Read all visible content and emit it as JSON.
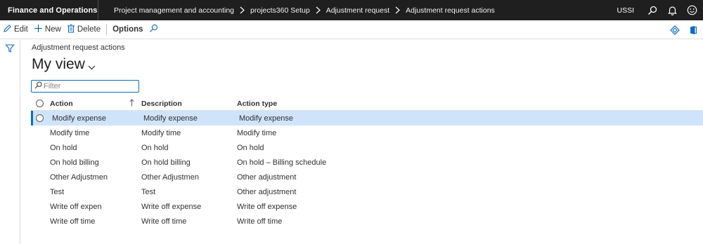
{
  "topbar": {
    "app_name": "Finance and Operations",
    "breadcrumbs": [
      "Project management and accounting",
      "projects360 Setup",
      "Adjustment request",
      "Adjustment request actions"
    ],
    "company": "USSI"
  },
  "actionpane": {
    "edit": "Edit",
    "new": "New",
    "delete": "Delete",
    "options": "Options"
  },
  "page": {
    "caption": "Adjustment request actions",
    "view_name": "My view",
    "filter_placeholder": "Filter"
  },
  "grid": {
    "columns": [
      "Action",
      "Description",
      "Action type"
    ],
    "rows": [
      {
        "action": "Modify expense",
        "description": "Modify expense",
        "type": "Modify expense"
      },
      {
        "action": "Modify time",
        "description": "Modify time",
        "type": "Modify time"
      },
      {
        "action": "On hold",
        "description": "On hold",
        "type": "On hold"
      },
      {
        "action": "On hold billing",
        "description": "On hold billing",
        "type": "On hold – Billing schedule"
      },
      {
        "action": "Other Adjustmen",
        "description": "Other Adjustmen",
        "type": "Other adjustment"
      },
      {
        "action": "Test",
        "description": "Test",
        "type": "Other adjustment"
      },
      {
        "action": "Write off expen",
        "description": "Write off expense",
        "type": "Write off expense"
      },
      {
        "action": "Write off time",
        "description": "Write off time",
        "type": "Write off time"
      }
    ],
    "selected_row": 0
  },
  "colors": {
    "topbar_bg": "#1f1f1f",
    "accent": "#0f6cbd",
    "selected_row_bg": "#cfe4fa"
  },
  "icons": [
    "search-icon",
    "bell-icon",
    "smiley-icon",
    "edit-icon",
    "plus-icon",
    "trash-icon",
    "diamond-icon",
    "office-icon",
    "filter-icon",
    "chevron-down-icon",
    "sort-up-icon"
  ]
}
